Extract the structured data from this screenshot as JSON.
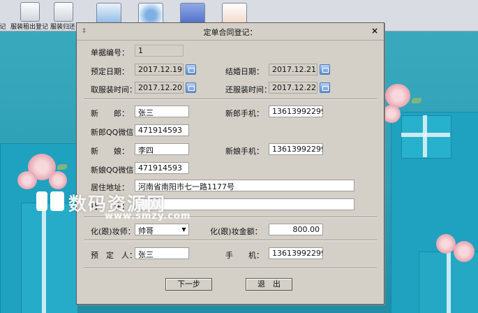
{
  "toolbar": {
    "buttons": [
      {
        "label": "记"
      },
      {
        "label": "服装租出登记"
      },
      {
        "label": "服装归还"
      },
      {
        "label": ""
      },
      {
        "label": ""
      },
      {
        "label": ""
      },
      {
        "label": ""
      }
    ]
  },
  "dialog": {
    "title": "定单合同登记：",
    "close_label": "×",
    "order_no": {
      "label": "单据编号：",
      "value": "1"
    },
    "booking_date": {
      "label": "预定日期：",
      "value": "2017.12.19"
    },
    "wedding_date": {
      "label": "结婚日期：",
      "value": "2017.12.21"
    },
    "pickup_time": {
      "label": "取服装时间：",
      "value": "2017.12.20"
    },
    "return_time": {
      "label": "还服装时间：",
      "value": "2017.12.22"
    },
    "groom": {
      "label": "新　　郎：",
      "value": "张三"
    },
    "groom_phone": {
      "label": "新郎手机：",
      "value": "13613992299"
    },
    "groom_qq": {
      "label": "新郎QQ微信：",
      "value": "471914593"
    },
    "bride": {
      "label": "新　　娘：",
      "value": "李四"
    },
    "bride_phone": {
      "label": "新娘手机：",
      "value": "13613992299"
    },
    "bride_qq": {
      "label": "新娘QQ微信：",
      "value": "471914593"
    },
    "address": {
      "label": "居住地址：",
      "value": "河南省南阳市七一路1177号"
    },
    "remark": {
      "label": "备　　注：",
      "value": ""
    },
    "makeup_artist": {
      "label": "化(跟)妆师：",
      "value": "帅哥"
    },
    "makeup_amount": {
      "label": "化(跟)妆金额：",
      "value": "800.00"
    },
    "booker": {
      "label": "预　定　人：",
      "value": "张三"
    },
    "phone": {
      "label": "手　　机：",
      "value": "13613992299"
    },
    "next_button": "下一步",
    "exit_button": "退　出"
  },
  "watermark": {
    "text": "数码资源网",
    "sub": "www.smzy.com"
  },
  "colors": {
    "dialog_bg": "#d4d0c8",
    "scene_bg": "#2ea3b8",
    "calendar_accent": "#5d8fd1"
  }
}
